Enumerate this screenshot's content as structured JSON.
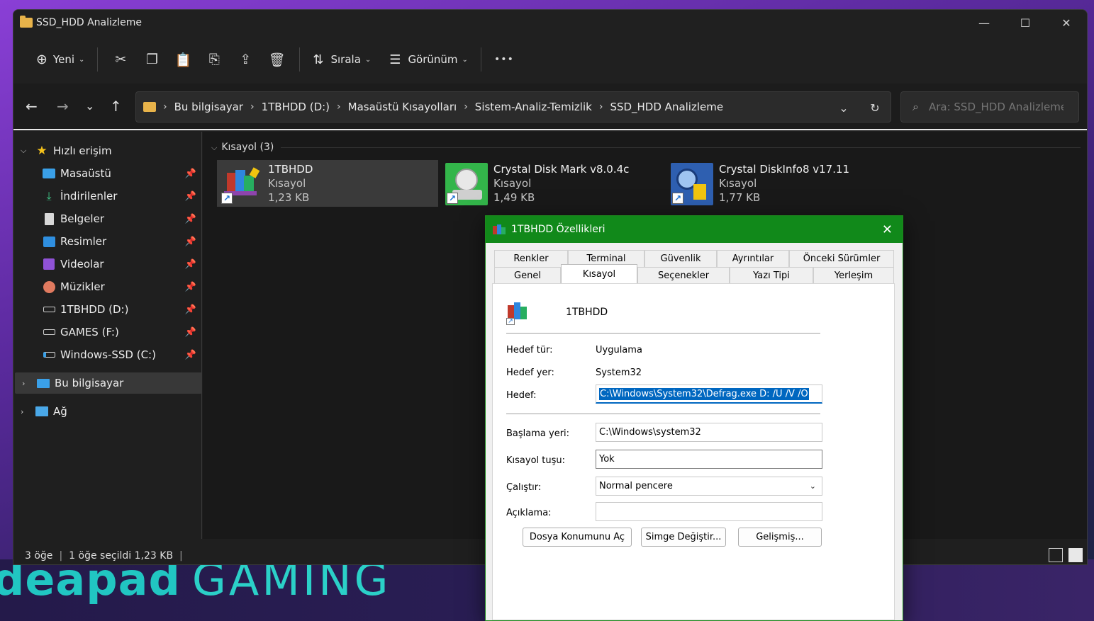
{
  "explorer": {
    "title": "SSD_HDD Analizleme",
    "window_controls": {
      "minimize": "—",
      "maximize": "☐",
      "close": "✕"
    },
    "toolbar": {
      "new_label": "Yeni",
      "sort_label": "Sırala",
      "view_label": "Görünüm",
      "more_label": "•••"
    },
    "breadcrumbs": [
      "Bu bilgisayar",
      "1TBHDD (D:)",
      "Masaüstü Kısayolları",
      "Sistem-Analiz-Temizlik",
      "SSD_HDD Analizleme"
    ],
    "search_placeholder": "Ara: SSD_HDD Analizleme",
    "sidebar": {
      "quick_access": "Hızlı erişim",
      "items": [
        {
          "label": "Masaüstü",
          "icon": "desktop-icon"
        },
        {
          "label": "İndirilenler",
          "icon": "download-icon"
        },
        {
          "label": "Belgeler",
          "icon": "documents-icon"
        },
        {
          "label": "Resimler",
          "icon": "pictures-icon"
        },
        {
          "label": "Videolar",
          "icon": "videos-icon"
        },
        {
          "label": "Müzikler",
          "icon": "music-icon"
        },
        {
          "label": "1TBHDD (D:)",
          "icon": "drive-icon"
        },
        {
          "label": "GAMES (F:)",
          "icon": "drive-icon"
        },
        {
          "label": "Windows-SSD (C:)",
          "icon": "system-drive-icon"
        }
      ],
      "this_pc": "Bu bilgisayar",
      "network": "Ağ"
    },
    "content": {
      "group_header": "Kısayol (3)",
      "files": [
        {
          "name": "1TBHDD",
          "type": "Kısayol",
          "size": "1,23 KB"
        },
        {
          "name": "Crystal Disk Mark v8.0.4c",
          "type": "Kısayol",
          "size": "1,49 KB"
        },
        {
          "name": "Crystal DiskInfo8 v17.11",
          "type": "Kısayol",
          "size": "1,77 KB"
        }
      ]
    },
    "status": {
      "count": "3 öğe",
      "selected": "1 öğe seçildi  1,23 KB"
    }
  },
  "dialog": {
    "title": "1TBHDD Özellikleri",
    "tabs_row1": [
      "Renkler",
      "Terminal",
      "Güvenlik",
      "Ayrıntılar",
      "Önceki Sürümler"
    ],
    "tabs_row2": [
      "Genel",
      "Kısayol",
      "Seçenekler",
      "Yazı Tipi",
      "Yerleşim"
    ],
    "shortcut_name": "1TBHDD",
    "target_type_label": "Hedef tür:",
    "target_type_value": "Uygulama",
    "target_location_label": "Hedef yer:",
    "target_location_value": "System32",
    "target_label": "Hedef:",
    "target_value": "C:\\Windows\\System32\\Defrag.exe D: /U /V /O",
    "start_in_label": "Başlama yeri:",
    "start_in_value": "C:\\Windows\\system32",
    "shortcut_key_label": "Kısayol tuşu:",
    "shortcut_key_value": "Yok",
    "run_label": "Çalıştır:",
    "run_value": "Normal pencere",
    "comment_label": "Açıklama:",
    "comment_value": "",
    "buttons": {
      "open_location": "Dosya Konumunu Aç",
      "change_icon": "Simge Değiştir...",
      "advanced": "Gelişmiş..."
    }
  },
  "wallpaper": {
    "brand_left": "deapad",
    "brand_right": "GAMING"
  },
  "colors": {
    "accent_green": "#11891a",
    "selection_blue": "#0067c0",
    "folder_yellow": "#e8b34a"
  }
}
